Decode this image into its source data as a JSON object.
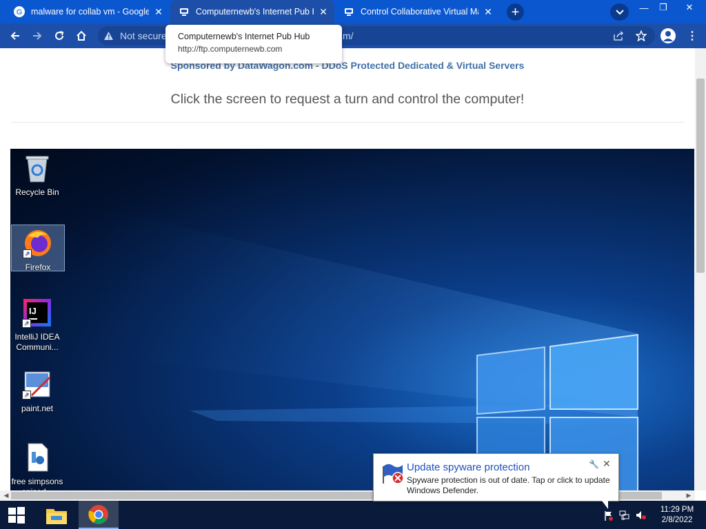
{
  "browser": {
    "tabs": [
      {
        "title": "malware for collab vm - Google S",
        "icon": "google-icon",
        "active": false
      },
      {
        "title": "Computernewb's Internet Pub Hu",
        "icon": "computernewb-icon",
        "active": true
      },
      {
        "title": "Control Collaborative Virtual Ma",
        "icon": "computernewb-icon",
        "active": false
      }
    ],
    "new_tab_label": "+",
    "address": {
      "security": "Not secure",
      "path_fragment": "m/"
    },
    "tooltip": {
      "title": "Computernewb's Internet Pub Hub",
      "url": "http://ftp.computernewb.com"
    }
  },
  "page": {
    "sponsor": "Sponsored by DataWagon.com - DDoS Protected Dedicated & Virtual Servers",
    "instruction": "Click the screen to request a turn and control the computer!"
  },
  "vm": {
    "desktop_icons": [
      {
        "label": "Recycle Bin",
        "icon": "recycle-bin-icon"
      },
      {
        "label": "Firefox",
        "icon": "firefox-icon",
        "selected": true
      },
      {
        "label": "IntelliJ IDEA Communi...",
        "icon": "intellij-icon"
      },
      {
        "label": "paint.net",
        "icon": "paint-net-icon"
      },
      {
        "label": "free simpsons episod...",
        "icon": "media-file-icon"
      }
    ],
    "taskbar": {
      "items": [
        "start-icon",
        "file-explorer-icon",
        "chrome-icon"
      ],
      "clock_time": "11:29 PM",
      "clock_date": "2/8/2022"
    },
    "notification": {
      "title": "Update spyware protection",
      "body": "Spyware protection is out of date. Tap or click to update Windows Defender."
    }
  },
  "colors": {
    "chrome_blue": "#0b57d0",
    "sponsor_link": "#3f6fa8",
    "notification_title": "#1e4fc0"
  }
}
